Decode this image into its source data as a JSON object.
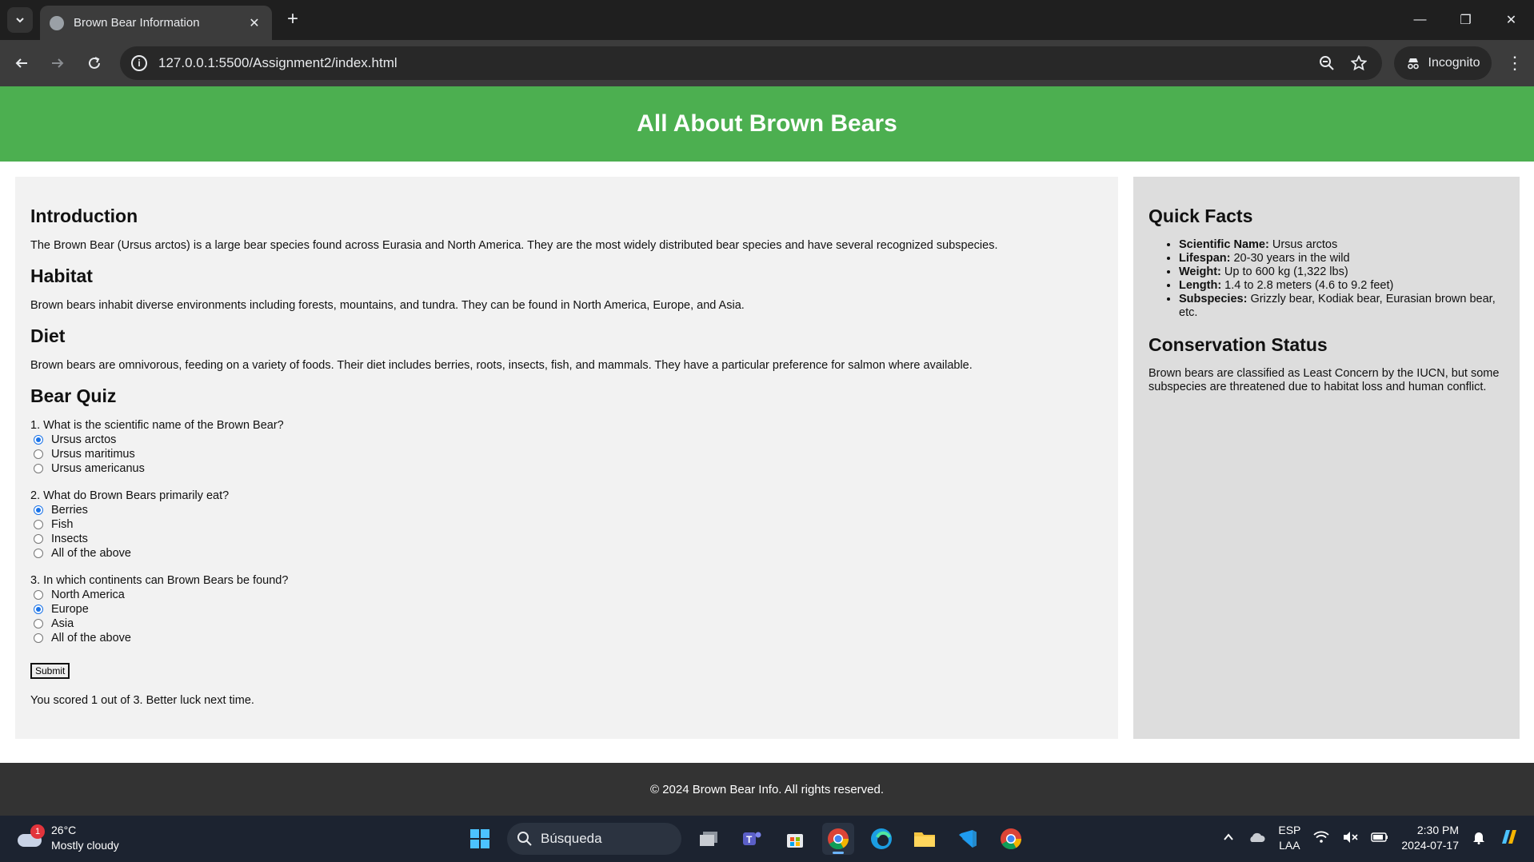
{
  "browser": {
    "tab_title": "Brown Bear Information",
    "url": "127.0.0.1:5500/Assignment2/index.html",
    "incognito_label": "Incognito"
  },
  "page": {
    "header_title": "All About Brown Bears",
    "sections": [
      {
        "heading": "Introduction",
        "text": "The Brown Bear (Ursus arctos) is a large bear species found across Eurasia and North America. They are the most widely distributed bear species and have several recognized subspecies."
      },
      {
        "heading": "Habitat",
        "text": "Brown bears inhabit diverse environments including forests, mountains, and tundra. They can be found in North America, Europe, and Asia."
      },
      {
        "heading": "Diet",
        "text": "Brown bears are omnivorous, feeding on a variety of foods. Their diet includes berries, roots, insects, fish, and mammals. They have a particular preference for salmon where available."
      }
    ],
    "quiz": {
      "heading": "Bear Quiz",
      "questions": [
        {
          "label": "1. What is the scientific name of the Brown Bear?",
          "options": [
            "Ursus arctos",
            "Ursus maritimus",
            "Ursus americanus"
          ],
          "selected": 0
        },
        {
          "label": "2. What do Brown Bears primarily eat?",
          "options": [
            "Berries",
            "Fish",
            "Insects",
            "All of the above"
          ],
          "selected": 0
        },
        {
          "label": "3. In which continents can Brown Bears be found?",
          "options": [
            "North America",
            "Europe",
            "Asia",
            "All of the above"
          ],
          "selected": 1
        }
      ],
      "submit_label": "Submit",
      "result": "You scored 1 out of 3. Better luck next time."
    },
    "aside": {
      "facts_heading": "Quick Facts",
      "facts": [
        {
          "label": "Scientific Name:",
          "value": " Ursus arctos"
        },
        {
          "label": "Lifespan:",
          "value": " 20-30 years in the wild"
        },
        {
          "label": "Weight:",
          "value": " Up to 600 kg (1,322 lbs)"
        },
        {
          "label": "Length:",
          "value": " 1.4 to 2.8 meters (4.6 to 9.2 feet)"
        },
        {
          "label": "Subspecies:",
          "value": " Grizzly bear, Kodiak bear, Eurasian brown bear, etc."
        }
      ],
      "conservation_heading": "Conservation Status",
      "conservation_text": "Brown bears are classified as Least Concern by the IUCN, but some subspecies are threatened due to habitat loss and human conflict."
    },
    "footer": "© 2024 Brown Bear Info. All rights reserved."
  },
  "taskbar": {
    "weather_badge": "1",
    "temperature": "26°C",
    "condition": "Mostly cloudy",
    "search_placeholder": "Búsqueda",
    "lang_line1": "ESP",
    "lang_line2": "LAA",
    "time": "2:30 PM",
    "date": "2024-07-17"
  },
  "colors": {
    "header_green": "#4caf50",
    "main_bg": "#f2f2f2",
    "aside_bg": "#dddddd",
    "footer_bg": "#333333",
    "radio_checked": "#1a73e8"
  }
}
